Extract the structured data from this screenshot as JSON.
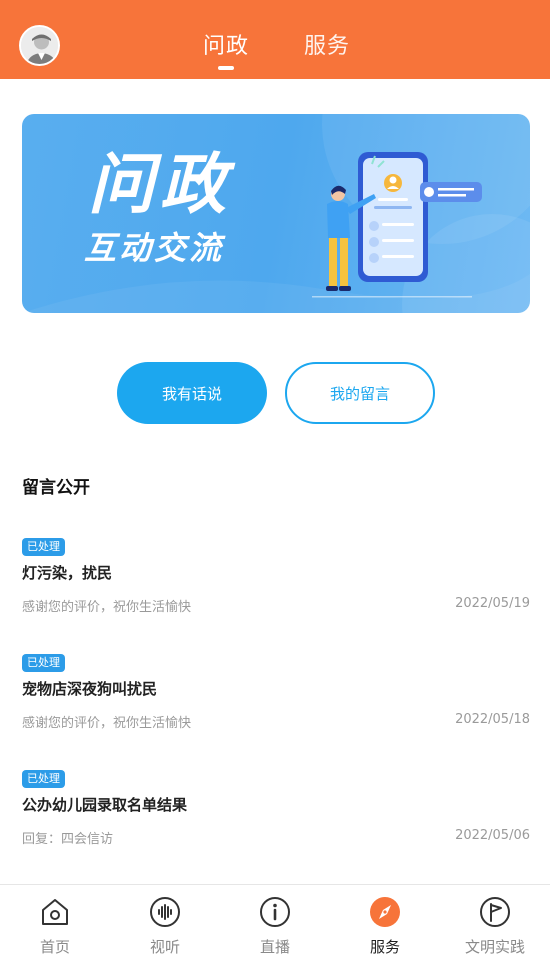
{
  "header": {
    "tabs": [
      {
        "label": "问政",
        "active": true
      },
      {
        "label": "服务",
        "active": false
      }
    ],
    "background_color": "#F7743A"
  },
  "banner": {
    "title": "问政",
    "subtitle": "互动交流"
  },
  "actions": {
    "primary_label": "我有话说",
    "secondary_label": "我的留言",
    "accent_color": "#1CA7EF"
  },
  "section": {
    "title": "留言公开"
  },
  "messages": [
    {
      "status": "已处理",
      "title": "灯污染，扰民",
      "reply": "感谢您的评价，祝你生活愉快",
      "date": "2022/05/19"
    },
    {
      "status": "已处理",
      "title": "宠物店深夜狗叫扰民",
      "reply": "感谢您的评价，祝你生活愉快",
      "date": "2022/05/18"
    },
    {
      "status": "已处理",
      "title": "公办幼儿园录取名单结果",
      "reply": "回复：四会信访",
      "date": "2022/05/06"
    }
  ],
  "bottom_nav": {
    "items": [
      {
        "label": "首页",
        "icon": "home-icon",
        "active": false
      },
      {
        "label": "视听",
        "icon": "audio-wave-icon",
        "active": false
      },
      {
        "label": "直播",
        "icon": "info-icon",
        "active": false
      },
      {
        "label": "服务",
        "icon": "compass-icon",
        "active": true
      },
      {
        "label": "文明实践",
        "icon": "flag-icon",
        "active": false
      }
    ],
    "active_color": "#F7743A"
  }
}
